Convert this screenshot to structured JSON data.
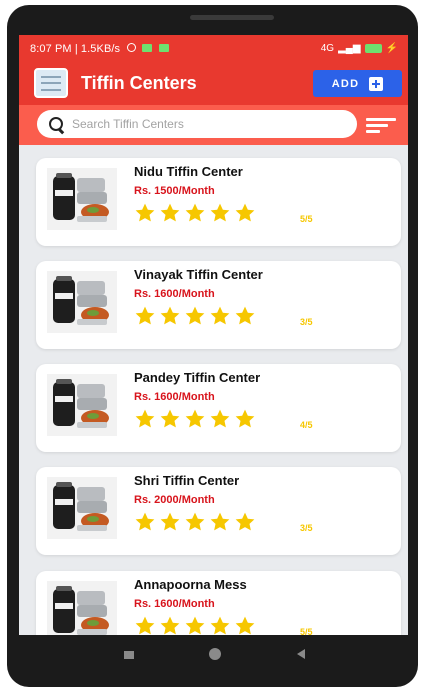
{
  "status": {
    "time": "8:07 PM | 1.5KB/s",
    "network": "4G"
  },
  "app": {
    "title": "Tiffin Centers",
    "add_label": "ADD"
  },
  "search": {
    "placeholder": "Search Tiffin Centers"
  },
  "items": [
    {
      "name": "Nidu Tiffin Center",
      "price": "Rs. 1500/Month",
      "rating": "5/5",
      "stars": 5
    },
    {
      "name": "Vinayak Tiffin Center",
      "price": "Rs. 1600/Month",
      "rating": "3/5",
      "stars": 5
    },
    {
      "name": "Pandey Tiffin Center",
      "price": "Rs. 1600/Month",
      "rating": "4/5",
      "stars": 5
    },
    {
      "name": "Shri Tiffin Center",
      "price": "Rs. 2000/Month",
      "rating": "3/5",
      "stars": 5
    },
    {
      "name": "Annapoorna Mess",
      "price": "Rs. 1600/Month",
      "rating": "5/5",
      "stars": 5
    }
  ],
  "colors": {
    "appbar": "#e8392f",
    "searchbar": "#fb5d4d",
    "add_button": "#2c62e8",
    "price": "#d8141c",
    "star": "#f6c700"
  },
  "icons": {
    "thumbnail": "tiffin-box-image",
    "search": "search-icon",
    "filter": "filter-icon"
  }
}
